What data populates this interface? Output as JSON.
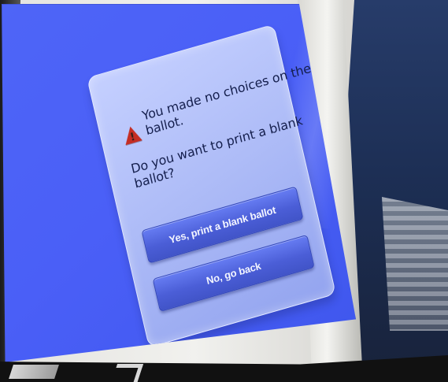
{
  "dialog": {
    "message_lines": [
      "You made no choices on the",
      "ballot.",
      "Do you want to print a blank",
      "ballot?"
    ],
    "buttons": {
      "yes": "Yes, print a blank ballot",
      "no": "No, go back"
    },
    "warning_icon": "warning-triangle-icon"
  },
  "colors": {
    "screen_blue": "#4a5ff7",
    "dialog_background": "#aebcf7",
    "button_blue": "#4b5ed7",
    "warning_red": "#c42d24"
  }
}
